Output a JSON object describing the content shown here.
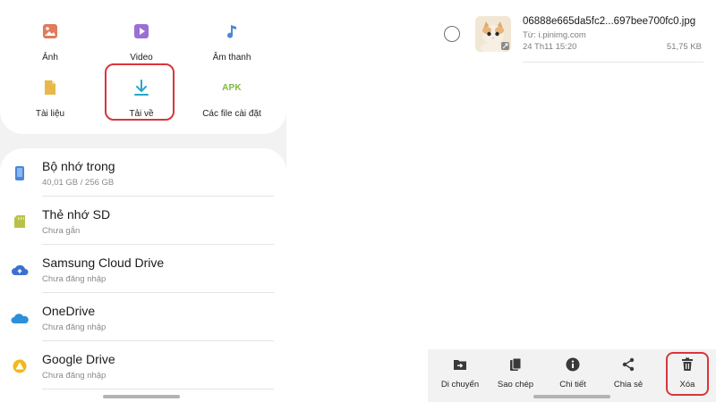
{
  "categories": {
    "items": [
      {
        "label": "Ảnh",
        "icon": "image-icon",
        "color": "#e27a5c"
      },
      {
        "label": "Video",
        "icon": "video-icon",
        "color": "#9b6fd6"
      },
      {
        "label": "Âm thanh",
        "icon": "music-note-icon",
        "color": "#4e86d6"
      },
      {
        "label": "Tài liệu",
        "icon": "document-icon",
        "color": "#e8b84a"
      },
      {
        "label": "Tải về",
        "icon": "download-icon",
        "color": "#27a7c9",
        "highlighted": true
      },
      {
        "label": "Các file cài đặt",
        "icon": "apk-icon",
        "icon_text": "APK",
        "color": "#7cbb3a"
      }
    ]
  },
  "storage": {
    "items": [
      {
        "title": "Bộ nhớ trong",
        "subtitle": "40,01 GB / 256 GB",
        "icon": "phone-storage-icon",
        "color": "#4a87d8"
      },
      {
        "title": "Thẻ nhớ SD",
        "subtitle": "Chưa gắn",
        "icon": "sd-card-icon",
        "color": "#b8c24a"
      },
      {
        "title": "Samsung Cloud Drive",
        "subtitle": "Chưa đăng nhập",
        "icon": "samsung-cloud-icon",
        "color": "#3c6fd0"
      },
      {
        "title": "OneDrive",
        "subtitle": "Chưa đăng nhập",
        "icon": "onedrive-icon",
        "color": "#2c8fd9"
      },
      {
        "title": "Google Drive",
        "subtitle": "Chưa đăng nhập",
        "icon": "google-drive-icon",
        "color": "#f2b81d"
      }
    ]
  },
  "file": {
    "name": "06888e665da5fc2...697bee700fc0.jpg",
    "source": "Từ: i.pinimg.com",
    "date": "24 Th11 15:20",
    "size": "51,75 KB",
    "selected": false
  },
  "actions": {
    "items": [
      {
        "label": "Di chuyển",
        "icon": "move-icon"
      },
      {
        "label": "Sao chép",
        "icon": "copy-icon"
      },
      {
        "label": "Chi tiết",
        "icon": "info-icon"
      },
      {
        "label": "Chia sẻ",
        "icon": "share-icon"
      },
      {
        "label": "Xóa",
        "icon": "trash-icon",
        "highlighted": true
      }
    ]
  },
  "colors": {
    "highlight": "#d9363b",
    "icon_dark": "#3a3a3a"
  }
}
